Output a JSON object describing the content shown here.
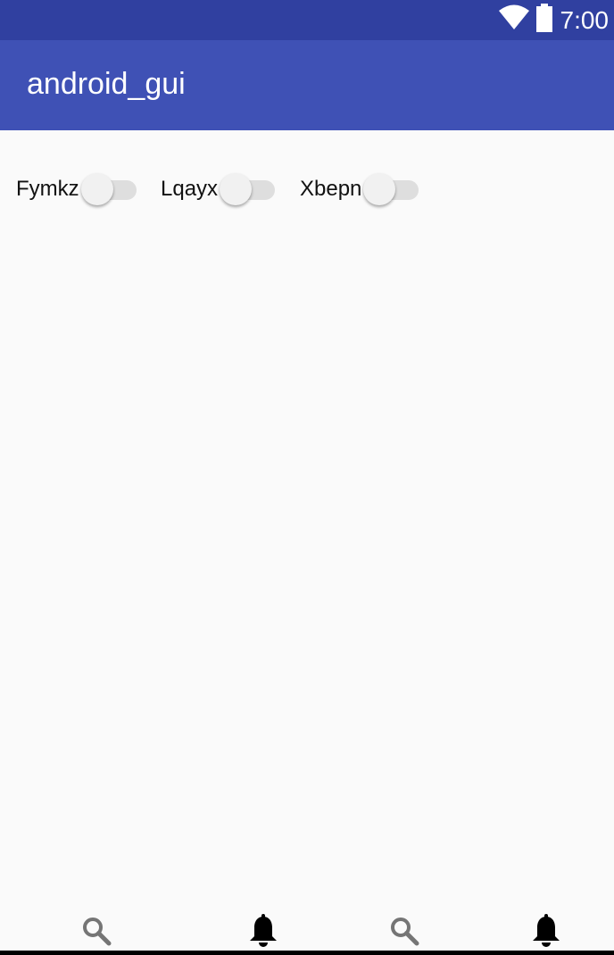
{
  "status_bar": {
    "time": "7:00",
    "icons": [
      "wifi-icon",
      "battery-icon"
    ]
  },
  "app_bar": {
    "title": "android_gui"
  },
  "switches": [
    {
      "label": "Fymkz",
      "checked": false
    },
    {
      "label": "Lqayx",
      "checked": false
    },
    {
      "label": "Xbepn",
      "checked": false
    }
  ],
  "bottom_nav": {
    "items": [
      {
        "icon": "search-icon"
      },
      {
        "icon": "bell-icon"
      },
      {
        "icon": "search-icon"
      },
      {
        "icon": "bell-icon"
      }
    ]
  },
  "colors": {
    "status_bar": "#3040a0",
    "app_bar": "#3f51b5",
    "background": "#fafafa"
  }
}
